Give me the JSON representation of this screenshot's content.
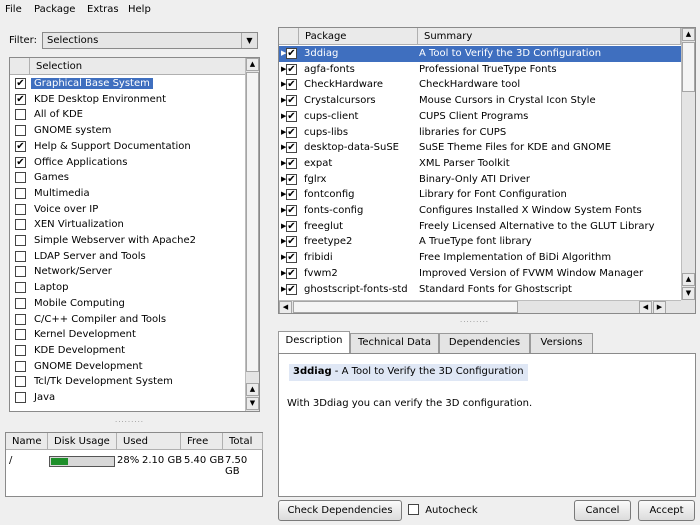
{
  "menubar": {
    "items": [
      "File",
      "Package",
      "Extras",
      "Help"
    ]
  },
  "filter": {
    "label": "Filter:",
    "value": "Selections"
  },
  "selections": {
    "header": "Selection",
    "items": [
      {
        "label": "Graphical Base System",
        "checked": true,
        "selected": true
      },
      {
        "label": "KDE Desktop Environment",
        "checked": true
      },
      {
        "label": "All of KDE",
        "checked": false
      },
      {
        "label": "GNOME system",
        "checked": false
      },
      {
        "label": "Help & Support Documentation",
        "checked": true
      },
      {
        "label": "Office Applications",
        "checked": true
      },
      {
        "label": "Games",
        "checked": false
      },
      {
        "label": "Multimedia",
        "checked": false
      },
      {
        "label": "Voice over IP",
        "checked": false
      },
      {
        "label": "XEN Virtualization",
        "checked": false
      },
      {
        "label": "Simple Webserver with Apache2",
        "checked": false
      },
      {
        "label": "LDAP Server and Tools",
        "checked": false
      },
      {
        "label": "Network/Server",
        "checked": false
      },
      {
        "label": "Laptop",
        "checked": false
      },
      {
        "label": "Mobile Computing",
        "checked": false
      },
      {
        "label": "C/C++ Compiler and Tools",
        "checked": false
      },
      {
        "label": "Kernel Development",
        "checked": false
      },
      {
        "label": "KDE Development",
        "checked": false
      },
      {
        "label": "GNOME Development",
        "checked": false
      },
      {
        "label": "Tcl/Tk Development System",
        "checked": false
      },
      {
        "label": "Java",
        "checked": false
      }
    ]
  },
  "disk": {
    "headers": [
      "Name",
      "Disk Usage",
      "Used",
      "Free",
      "Total"
    ],
    "rows": [
      {
        "name": "/",
        "percent_label": "28%",
        "percent": 0.28,
        "used": "2.10 GB",
        "free": "5.40 GB",
        "total": "7.50 GB"
      }
    ],
    "bar_color": "#1e8f2a"
  },
  "packages": {
    "headers": [
      "Package",
      "Summary"
    ],
    "rows": [
      {
        "name": "3ddiag",
        "summary": "A Tool to Verify the 3D Configuration",
        "selected": true
      },
      {
        "name": "agfa-fonts",
        "summary": "Professional TrueType Fonts"
      },
      {
        "name": "CheckHardware",
        "summary": "CheckHardware tool"
      },
      {
        "name": "Crystalcursors",
        "summary": "Mouse Cursors in Crystal Icon Style"
      },
      {
        "name": "cups-client",
        "summary": "CUPS Client Programs"
      },
      {
        "name": "cups-libs",
        "summary": "libraries for CUPS"
      },
      {
        "name": "desktop-data-SuSE",
        "summary": "SuSE Theme Files for KDE and GNOME"
      },
      {
        "name": "expat",
        "summary": "XML Parser Toolkit"
      },
      {
        "name": "fglrx",
        "summary": "Binary-Only ATI Driver"
      },
      {
        "name": "fontconfig",
        "summary": "Library for Font Configuration"
      },
      {
        "name": "fonts-config",
        "summary": "Configures Installed X Window System Fonts"
      },
      {
        "name": "freeglut",
        "summary": "Freely Licensed Alternative to the GLUT Library"
      },
      {
        "name": "freetype2",
        "summary": "A TrueType font library"
      },
      {
        "name": "fribidi",
        "summary": "Free Implementation of BiDi Algorithm"
      },
      {
        "name": "fvwm2",
        "summary": "Improved Version of FVWM Window Manager"
      },
      {
        "name": "ghostscript-fonts-std",
        "summary": "Standard Fonts for Ghostscript"
      }
    ]
  },
  "tabs": [
    "Description",
    "Technical Data",
    "Dependencies",
    "Versions"
  ],
  "description": {
    "title_name": "3ddiag",
    "title_rest": " - A Tool to Verify the 3D Configuration",
    "body": "With 3Ddiag you can verify the 3D configuration."
  },
  "buttons": {
    "check_dependencies": "Check Dependencies",
    "autocheck": "Autocheck",
    "cancel": "Cancel",
    "accept": "Accept"
  },
  "colors": {
    "selection": "#3f6fbf",
    "window": "#efefef"
  }
}
